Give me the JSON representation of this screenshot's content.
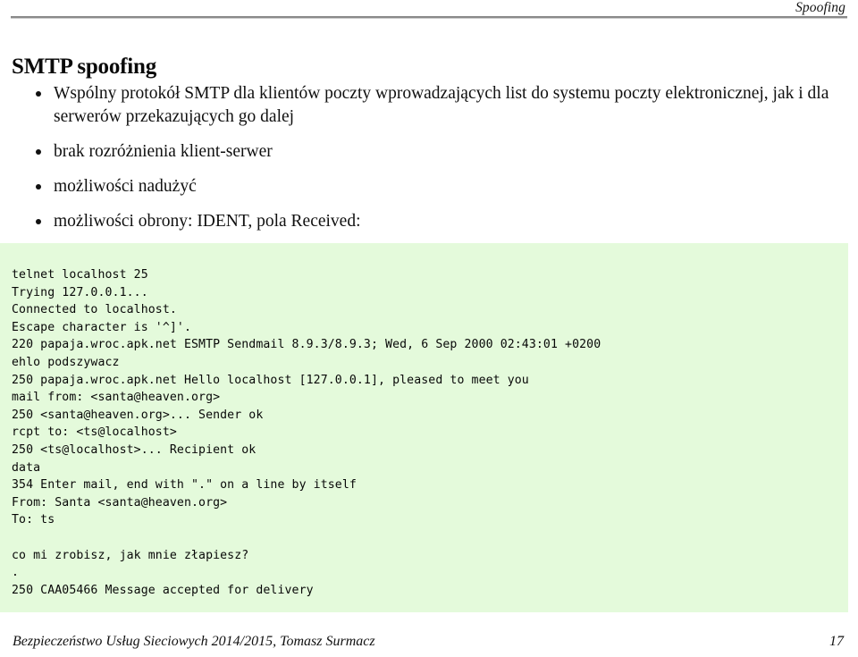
{
  "header": {
    "section_title": "Spoofing"
  },
  "slide": {
    "title": "SMTP spoofing"
  },
  "bullets": [
    {
      "text": "Wspólny protokół SMTP dla klientów poczty wprowadzających list do systemu poczty elektronicznej, jak i dla serwerów przekazujących go dalej"
    },
    {
      "text": "brak rozróżnienia klient-serwer"
    },
    {
      "text": "możliwości nadużyć"
    },
    {
      "text": "możliwości obrony: IDENT, pola Received:"
    }
  ],
  "terminal": {
    "background_color": "#e4fadb",
    "lines": [
      "telnet localhost 25",
      "Trying 127.0.0.1...",
      "Connected to localhost.",
      "Escape character is '^]'.",
      "220 papaja.wroc.apk.net ESMTP Sendmail 8.9.3/8.9.3; Wed, 6 Sep 2000 02:43:01 +0200",
      "ehlo podszywacz",
      "250 papaja.wroc.apk.net Hello localhost [127.0.0.1], pleased to meet you",
      "mail from: <santa@heaven.org>",
      "250 <santa@heaven.org>... Sender ok",
      "rcpt to: <ts@localhost>",
      "250 <ts@localhost>... Recipient ok",
      "data",
      "354 Enter mail, end with \".\" on a line by itself",
      "From: Santa <santa@heaven.org>",
      "To: ts",
      "",
      "co mi zrobisz, jak mnie złapiesz?",
      ".",
      "250 CAA05466 Message accepted for delivery"
    ],
    "text": "telnet localhost 25\nTrying 127.0.0.1...\nConnected to localhost.\nEscape character is '^]'.\n220 papaja.wroc.apk.net ESMTP Sendmail 8.9.3/8.9.3; Wed, 6 Sep 2000 02:43:01 +0200\nehlo podszywacz\n250 papaja.wroc.apk.net Hello localhost [127.0.0.1], pleased to meet you\nmail from: <santa@heaven.org>\n250 <santa@heaven.org>... Sender ok\nrcpt to: <ts@localhost>\n250 <ts@localhost>... Recipient ok\ndata\n354 Enter mail, end with \".\" on a line by itself\nFrom: Santa <santa@heaven.org>\nTo: ts\n\nco mi zrobisz, jak mnie złapiesz?\n.\n250 CAA05466 Message accepted for delivery"
  },
  "footer": {
    "course": "Bezpieczeństwo Usług Sieciowych 2014/2015, Tomasz Surmacz",
    "page_number": "17"
  }
}
